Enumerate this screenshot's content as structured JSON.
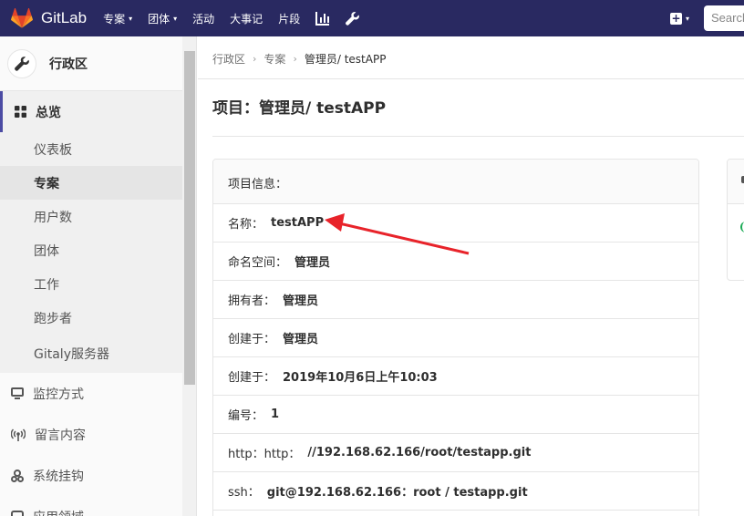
{
  "navbar": {
    "brand": "GitLab",
    "items": [
      {
        "label": "专案",
        "dropdown": true
      },
      {
        "label": "团体",
        "dropdown": true
      },
      {
        "label": "活动",
        "dropdown": false
      },
      {
        "label": "大事记",
        "dropdown": false
      },
      {
        "label": "片段",
        "dropdown": false
      }
    ],
    "icons": [
      "chart-icon",
      "wrench-icon"
    ],
    "search_placeholder": "Search",
    "caret": "▾"
  },
  "sidebar": {
    "title": "行政区",
    "overview_label": "总览",
    "sub_items": [
      "仪表板",
      "专案",
      "用户数",
      "团体",
      "工作",
      "跑步者",
      "Gitaly服务器"
    ],
    "selected_sub": "专案",
    "main_items": [
      {
        "label": "监控方式",
        "icon": "monitor-icon"
      },
      {
        "label": "留言内容",
        "icon": "broadcast-icon"
      },
      {
        "label": "系统挂钩",
        "icon": "hook-icon"
      },
      {
        "label": "应用领域",
        "icon": "apps-icon"
      }
    ]
  },
  "breadcrumb": {
    "items": [
      "行政区",
      "专案",
      "管理员/ testAPP"
    ],
    "separator": "›"
  },
  "page": {
    "title": "项目：管理员/ testAPP"
  },
  "info_panel": {
    "heading": "项目信息：",
    "rows": [
      {
        "label": "名称：",
        "value": "testAPP"
      },
      {
        "label": "命名空间：",
        "value": "管理员"
      },
      {
        "label": "拥有者：",
        "value": "管理员"
      },
      {
        "label": "创建于：",
        "value": "管理员"
      },
      {
        "label": "创建于：",
        "value": "2019年10月6日上午10:03"
      },
      {
        "label": "编号：",
        "value": "1"
      },
      {
        "label": "http：http：",
        "value": "//192.168.62.166/root/testapp.git"
      },
      {
        "label": "ssh：",
        "value": "git@192.168.62.166：root / testapp.git"
      }
    ]
  },
  "colors": {
    "navbar": "#292961",
    "annotation_arrow": "#e8232a"
  }
}
